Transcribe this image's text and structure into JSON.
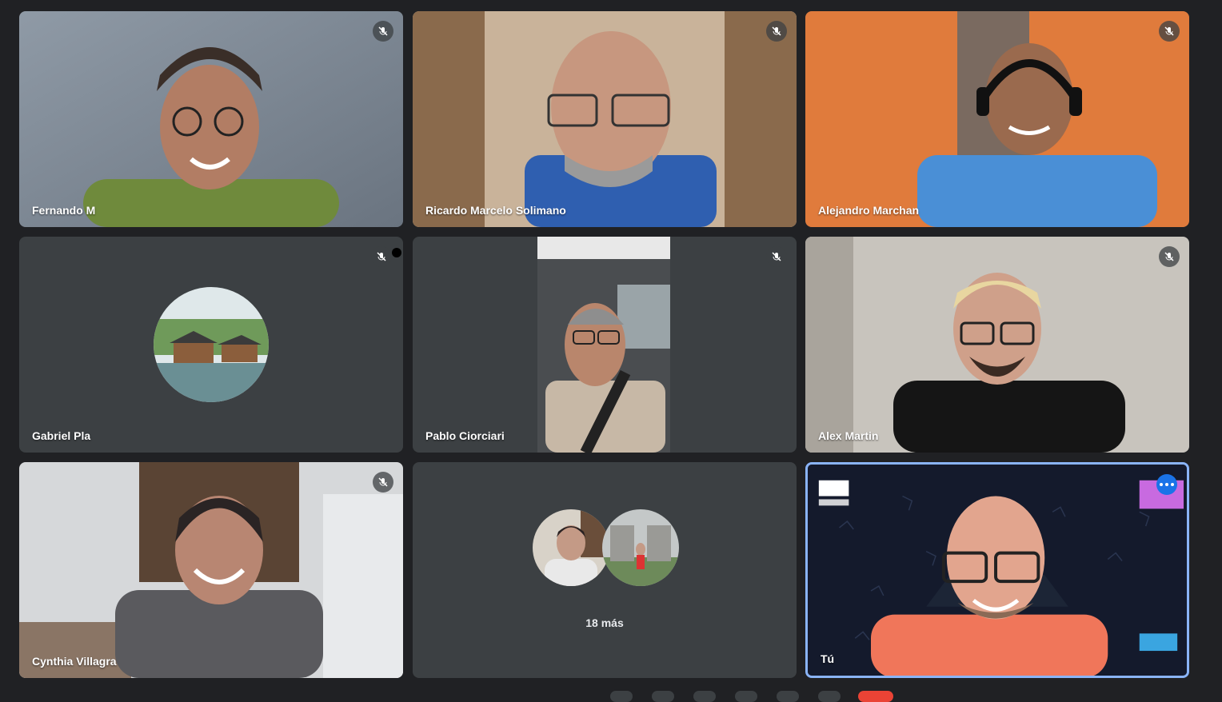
{
  "participants": [
    {
      "name": "Fernando M",
      "muted": true
    },
    {
      "name": "Ricardo Marcelo Solimano",
      "muted": true
    },
    {
      "name": "Alejandro Marchan",
      "muted": true
    },
    {
      "name": "Gabriel Pla",
      "muted": true
    },
    {
      "name": "Pablo Ciorciari",
      "muted": true
    },
    {
      "name": "Alex Martin",
      "muted": true
    },
    {
      "name": "Cynthia Villagra",
      "muted": true
    },
    {
      "name": "Tú",
      "muted": false,
      "speaking": true
    }
  ],
  "overflow": {
    "label": "18 más"
  },
  "icons": {
    "mic_off": "mic-off-icon",
    "more": "more-options-icon"
  },
  "colors": {
    "background": "#202124",
    "tile": "#3c4043",
    "speaking_border": "#8ab4f8",
    "accent": "#1a73e8",
    "end_call": "#ea4335"
  }
}
